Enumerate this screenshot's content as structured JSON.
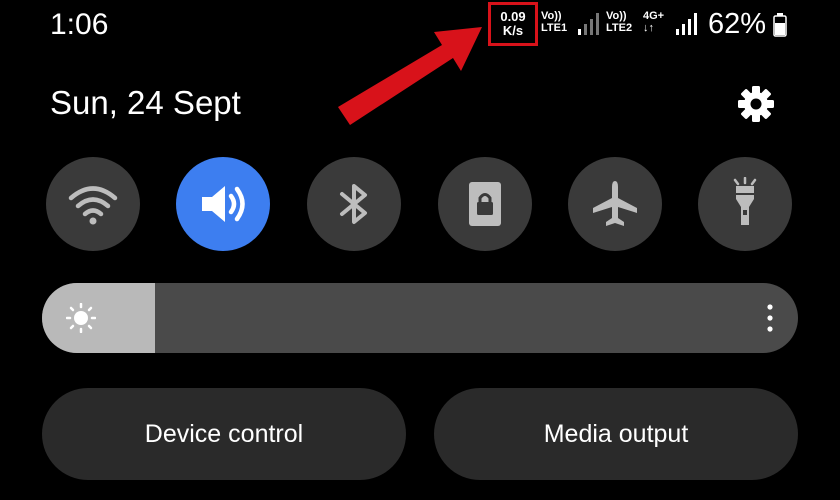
{
  "status_bar": {
    "time": "1:06",
    "network_speed_value": "0.09",
    "network_speed_unit": "K/s",
    "sim1_label_top": "Vo))",
    "sim1_label_bottom": "LTE1",
    "sim2_label_top": "Vo))",
    "sim2_label_bottom": "LTE2",
    "data_type_top": "4G+",
    "data_type_bottom": "↓↑",
    "battery_percent": "62%",
    "battery_level": 0.62
  },
  "header": {
    "date": "Sun, 24 Sept",
    "settings_icon": "gear-icon"
  },
  "quick_toggles": [
    {
      "icon": "wifi-icon",
      "active": false
    },
    {
      "icon": "sound-icon",
      "active": true
    },
    {
      "icon": "bluetooth-icon",
      "active": false
    },
    {
      "icon": "portrait-lock-icon",
      "active": false
    },
    {
      "icon": "airplane-icon",
      "active": false
    },
    {
      "icon": "flashlight-icon",
      "active": false
    }
  ],
  "brightness": {
    "level": 0.15,
    "icon": "sun-icon"
  },
  "buttons": {
    "device_control": "Device control",
    "media_output": "Media output"
  },
  "colors": {
    "accent": "#3d7ef0",
    "highlight": "#d8121a",
    "tile": "#3a3a3a",
    "background": "#000000"
  }
}
